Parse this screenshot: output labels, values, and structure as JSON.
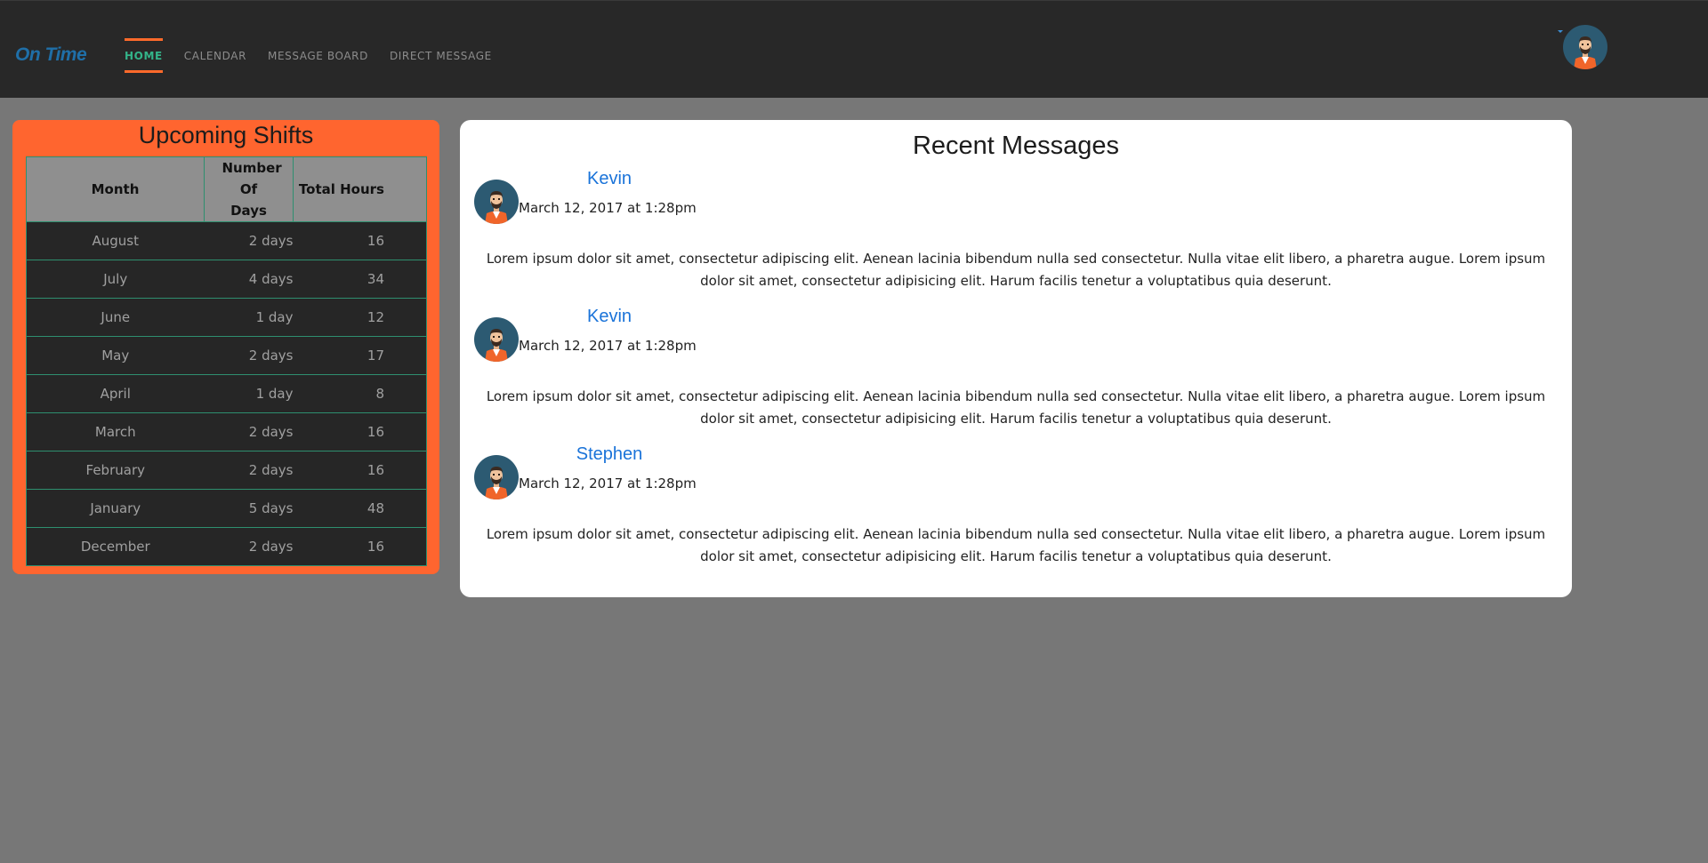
{
  "header": {
    "logo": "On Time",
    "nav": [
      "HOME",
      "CALENDAR",
      "MESSAGE BOARD",
      "DIRECT MESSAGE"
    ],
    "active_nav": "HOME",
    "colors": {
      "nav_bg": "#282828",
      "accent": "#ff6a2b",
      "active_text": "#33b489",
      "logo": "#1f6fa8"
    }
  },
  "shifts": {
    "title": "Upcoming Shifts",
    "columns": {
      "month": "Month",
      "days": "Number Of Days",
      "hours": "Total Hours"
    },
    "rows": [
      {
        "month": "August",
        "days": "2 days",
        "hours": "16"
      },
      {
        "month": "July",
        "days": "4 days",
        "hours": "34"
      },
      {
        "month": "June",
        "days": "1 day",
        "hours": "12"
      },
      {
        "month": "May",
        "days": "2 days",
        "hours": "17"
      },
      {
        "month": "April",
        "days": "1 day",
        "hours": "8"
      },
      {
        "month": "March",
        "days": "2 days",
        "hours": "16"
      },
      {
        "month": "February",
        "days": "2 days",
        "hours": "16"
      },
      {
        "month": "January",
        "days": "5 days",
        "hours": "48"
      },
      {
        "month": "December",
        "days": "2 days",
        "hours": "16"
      }
    ],
    "colors": {
      "panel": "#ff652f",
      "header": "#8f8f8f",
      "row": "#262626",
      "border": "#2e8f6f"
    }
  },
  "messages": {
    "title": "Recent Messages",
    "items": [
      {
        "author": "Kevin",
        "date": "March 12, 2017 at 1:28pm",
        "body": "Lorem ipsum dolor sit amet, consectetur adipiscing elit. Aenean lacinia bibendum nulla sed consectetur. Nulla vitae elit libero, a pharetra augue. Lorem ipsum dolor sit amet, consectetur adipisicing elit. Harum facilis tenetur a voluptatibus quia deserunt."
      },
      {
        "author": "Kevin",
        "date": "March 12, 2017 at 1:28pm",
        "body": "Lorem ipsum dolor sit amet, consectetur adipiscing elit. Aenean lacinia bibendum nulla sed consectetur. Nulla vitae elit libero, a pharetra augue. Lorem ipsum dolor sit amet, consectetur adipisicing elit. Harum facilis tenetur a voluptatibus quia deserunt."
      },
      {
        "author": "Stephen",
        "date": "March 12, 2017 at 1:28pm",
        "body": "Lorem ipsum dolor sit amet, consectetur adipiscing elit. Aenean lacinia bibendum nulla sed consectetur. Nulla vitae elit libero, a pharetra augue. Lorem ipsum dolor sit amet, consectetur adipisicing elit. Harum facilis tenetur a voluptatibus quia deserunt."
      }
    ],
    "author_color": "#1a73d9"
  },
  "icons": {
    "avatar": "user-avatar-icon",
    "caret": "caret-down-icon"
  }
}
